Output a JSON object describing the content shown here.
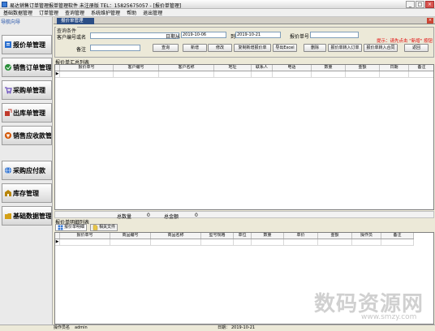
{
  "window": {
    "title": "易达销售订单管理报单管理软件 未注册版 TEL：15825675057 - [报价单管理]",
    "minimize": "_",
    "maximize": "□",
    "close": "×"
  },
  "menu": [
    "基础数据管理",
    "订单管理",
    "查询管理",
    "系统维护管理",
    "帮助",
    "退出管理"
  ],
  "sidebar": {
    "title": "导航向导",
    "items": [
      {
        "label": "报价单管理",
        "color": "#2a6fd0"
      },
      {
        "label": "销售订单管理",
        "color": "#2a8f3a"
      },
      {
        "label": "采购单管理",
        "color": "#6b4fbf"
      },
      {
        "label": "出库单管理",
        "color": "#c0392b"
      },
      {
        "label": "销售应收款管理",
        "color": "#d35400"
      },
      {
        "label": "采购应付款",
        "color": "#2a6fd0"
      },
      {
        "label": "库存管理",
        "color": "#b8860b"
      },
      {
        "label": "基础数据管理",
        "color": "#d4a017"
      }
    ]
  },
  "tab": {
    "label": "报价单管理",
    "close": "×"
  },
  "query": {
    "legend": "查询条件",
    "customer_label": "客户编号或名",
    "customer_value": "",
    "date_label": "日期从",
    "date_from": "2019-10-06",
    "to_label": "到",
    "date_to": "2019-10-21",
    "quote_no_label": "报价单号",
    "quote_no_value": "",
    "remark_label": "备注",
    "remark_value": "",
    "hint": "提示：请先点击 \"新增\" 按钮"
  },
  "buttons": {
    "query": "查询",
    "add": "新增",
    "edit": "修改",
    "copy_new": "复制新增报价单",
    "export": "导出Excel",
    "delete": "删除",
    "to_order": "报价单转入订单",
    "to_contract": "报价单转入合同",
    "back": "返回"
  },
  "summary_list": {
    "legend": "报价单汇总列表",
    "columns": [
      "报价单号",
      "客户编号",
      "客户名称",
      "地址",
      "联系人",
      "电话",
      "数量",
      "金额",
      "日期",
      "备注"
    ],
    "total_qty_label": "总数量",
    "total_qty": "0",
    "total_amount_label": "总金额",
    "total_amount": "0"
  },
  "detail_list": {
    "legend": "报价单明细列表",
    "tabs": [
      "报价单明细",
      "相关文件"
    ],
    "columns": [
      "报价单号",
      "商品编号",
      "商品名称",
      "型号规格",
      "单位",
      "数量",
      "单价",
      "金额",
      "操作员",
      "备注"
    ]
  },
  "status": {
    "operator_label": "操作员名",
    "operator": "admin",
    "date_label": "日期：",
    "date": "2019-10-21"
  },
  "watermark": {
    "main": "数码资源网",
    "sub": "www.smzy.com"
  }
}
